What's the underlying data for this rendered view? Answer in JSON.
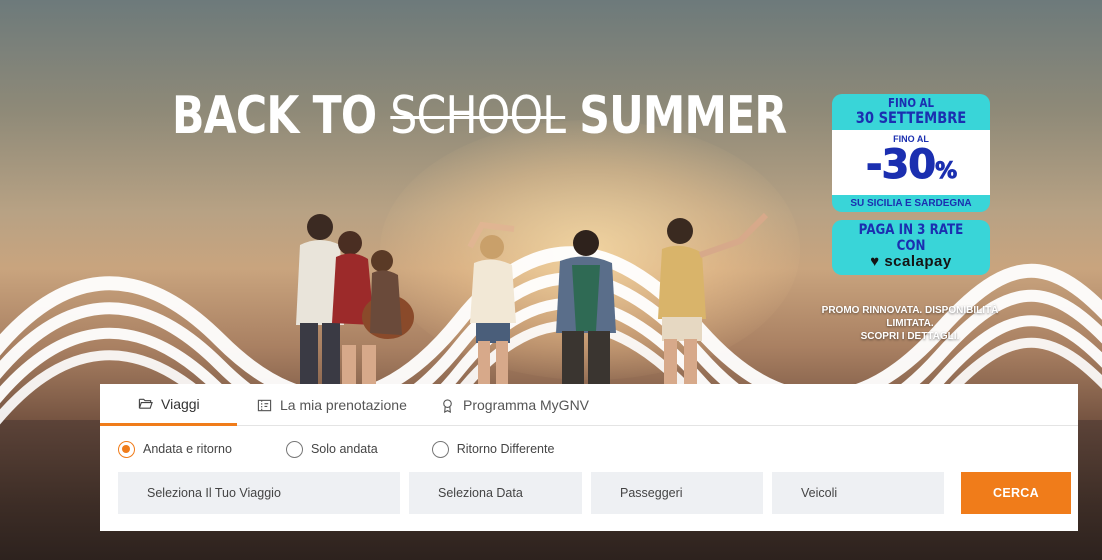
{
  "hero": {
    "headline_part1": "BACK TO",
    "headline_strike": "SCHOOL",
    "headline_part2": "SUMMER"
  },
  "promo": {
    "until_label": "FINO AL",
    "until_date": "30 SETTEMBRE",
    "discount_prefix": "FINO AL",
    "discount_value": "-30",
    "discount_unit": "%",
    "discount_scope": "SU SICILIA E SARDEGNA",
    "installments_text": "PAGA IN 3 RATE CON",
    "installments_brand": "scalapay",
    "note_line1": "PROMO RINNOVATA. DISPONIBILITÀ LIMITATA.",
    "note_line2": "SCOPRI I DETTAGLI."
  },
  "tabs": [
    {
      "label": "Viaggi",
      "icon": "folder-open-icon",
      "active": true
    },
    {
      "label": "La mia prenotazione",
      "icon": "ticket-icon",
      "active": false
    },
    {
      "label": "Programma MyGNV",
      "icon": "award-icon",
      "active": false
    }
  ],
  "trip_types": [
    {
      "label": "Andata e ritorno",
      "checked": true
    },
    {
      "label": "Solo andata",
      "checked": false
    },
    {
      "label": "Ritorno Differente",
      "checked": false
    }
  ],
  "fields": {
    "trip": "Seleziona Il Tuo Viaggio",
    "date": "Seleziona Data",
    "passengers": "Passeggeri",
    "vehicles": "Veicoli"
  },
  "search_button": "CERCA",
  "colors": {
    "accent": "#f07c1a",
    "promo_cyan": "#39d5d8",
    "promo_blue": "#1b2fb0",
    "field_bg": "#eef0f3"
  }
}
